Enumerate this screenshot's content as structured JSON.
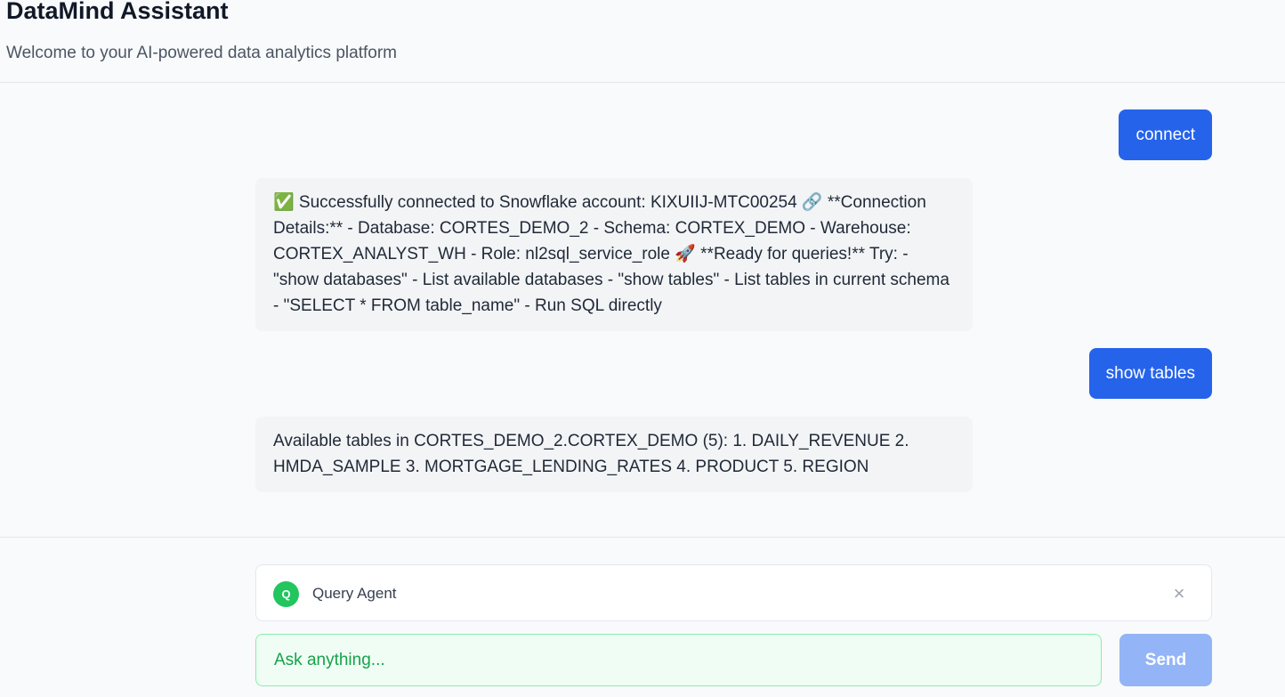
{
  "header": {
    "title": "DataMind Assistant",
    "subtitle": "Welcome to your AI-powered data analytics platform"
  },
  "messages": [
    {
      "role": "user",
      "text": "connect"
    },
    {
      "role": "assistant",
      "text": "✅ Successfully connected to Snowflake account: KIXUIIJ-MTC00254 🔗 **Connection Details:** - Database: CORTES_DEMO_2 - Schema: CORTEX_DEMO - Warehouse: CORTEX_ANALYST_WH - Role: nl2sql_service_role 🚀 **Ready for queries!** Try: - \"show databases\" - List available databases - \"show tables\" - List tables in current schema - \"SELECT * FROM table_name\" - Run SQL directly"
    },
    {
      "role": "user",
      "text": "show tables"
    },
    {
      "role": "assistant",
      "text": "Available tables in CORTES_DEMO_2.CORTEX_DEMO (5): 1. DAILY_REVENUE 2. HMDA_SAMPLE 3. MORTGAGE_LENDING_RATES 4. PRODUCT 5. REGION"
    }
  ],
  "agent": {
    "badge": "Q",
    "name": "Query Agent",
    "badge_color": "#22c55e",
    "close_icon": "close-icon"
  },
  "composer": {
    "placeholder": "Ask anything...",
    "value": "",
    "send_label": "Send"
  },
  "colors": {
    "accent": "#2563eb",
    "send_disabled": "#93b4f6",
    "input_border": "#86efac"
  }
}
